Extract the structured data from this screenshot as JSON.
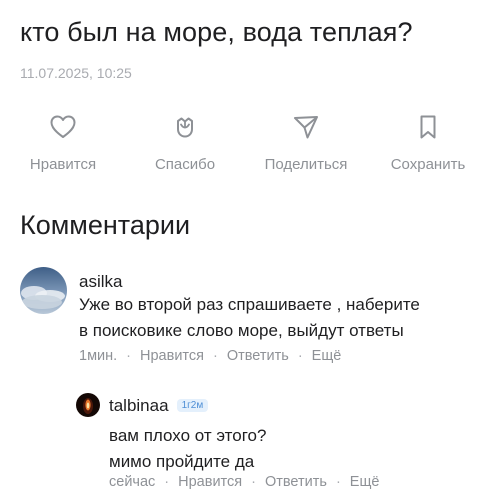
{
  "post": {
    "title": "кто был на море, вода теплая?",
    "date": "11.07.2025, 10:25"
  },
  "actions": [
    {
      "label": "Нравится",
      "icon": "heart-icon"
    },
    {
      "label": "Спасибо",
      "icon": "flower-icon"
    },
    {
      "label": "Поделиться",
      "icon": "send-icon"
    },
    {
      "label": "Сохранить",
      "icon": "bookmark-icon"
    }
  ],
  "comments_section": {
    "title": "Комментарии"
  },
  "comments": [
    {
      "username": "asilka",
      "text": "Уже во второй раз спрашиваете , наберите\nв поисковике слово море, выйдут ответы",
      "time": "1мин.",
      "like": "Нравится",
      "reply": "Ответить",
      "more": "Ещё"
    },
    {
      "username": "talbinaa",
      "badge": "1г2м",
      "text": "вам плохо от этого?\nмимо пройдите да",
      "time": "сейчас",
      "like": "Нравится",
      "reply": "Ответить",
      "more": "Ещё"
    }
  ],
  "colors": {
    "text_primary": "#1f1f21",
    "text_secondary": "#8e9196",
    "icon_gray": "#8e9196",
    "badge_bg": "#e4f0fc",
    "badge_text": "#4f8fd6"
  }
}
